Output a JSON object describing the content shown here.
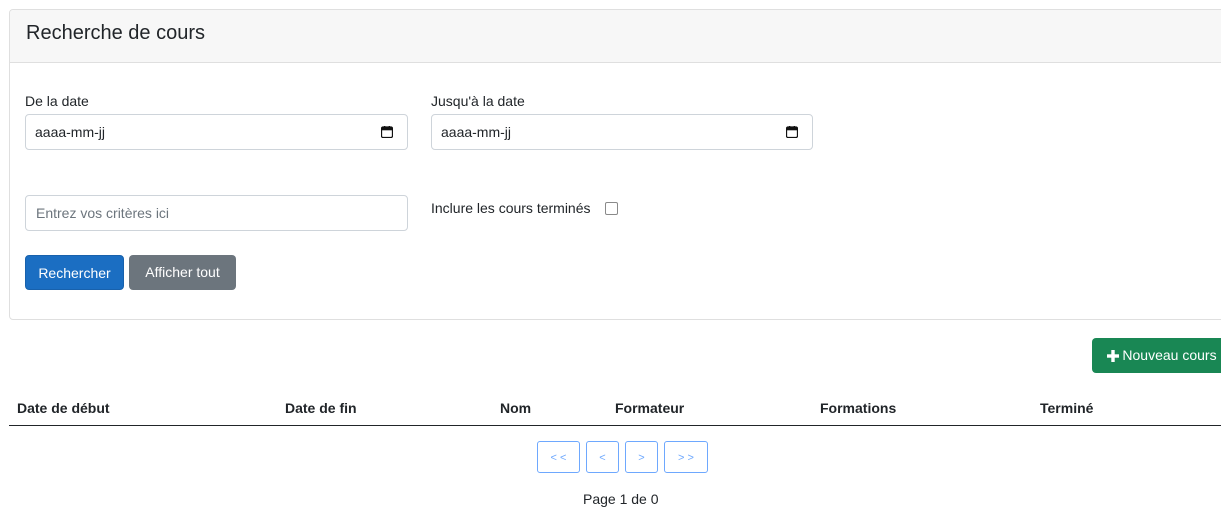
{
  "search_panel": {
    "title": "Recherche de cours",
    "from_date_label": "De la date",
    "from_date_placeholder": "aaaa-mm-jj",
    "to_date_label": "Jusqu'à la date",
    "to_date_placeholder": "aaaa-mm-jj",
    "criteria_placeholder": "Entrez vos critères ici",
    "include_finished_label": "Inclure les cours terminés",
    "include_finished_checked": false,
    "search_button": "Rechercher",
    "show_all_button": "Afficher tout"
  },
  "new_course_button": "Nouveau cours",
  "table": {
    "columns": [
      "Date de début",
      "Date de fin",
      "Nom",
      "Formateur",
      "Formations",
      "Terminé"
    ],
    "rows": []
  },
  "pagination": {
    "first": "< <",
    "prev": "<",
    "next": ">",
    "last": "> >",
    "page_info": "Page 1 de 0"
  },
  "colors": {
    "primary": "#1b6ec2",
    "secondary": "#6c757d",
    "success": "#198754",
    "pagination_outline": "#6ea8fe"
  }
}
